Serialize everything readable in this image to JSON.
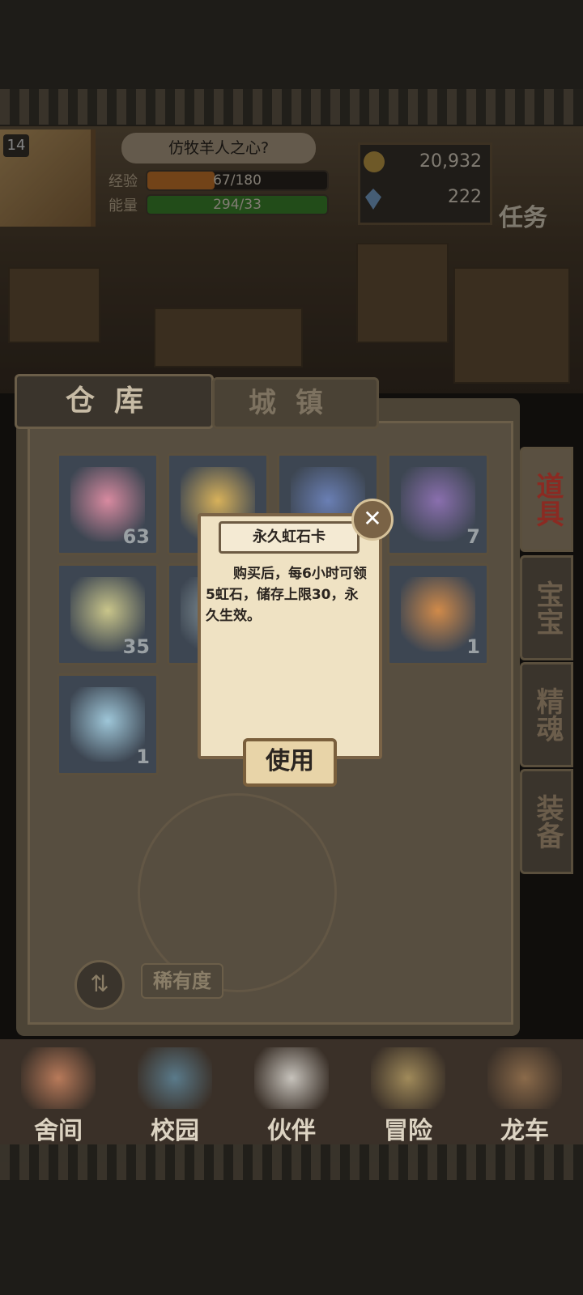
{
  "header": {
    "level": "14",
    "title": "仿牧羊人之心?",
    "exp_label": "经验",
    "exp_value": "67/180",
    "exp_fraction": 0.372,
    "energy_label": "能量",
    "energy_value": "294/33",
    "energy_fraction": 1.0,
    "gold": "20,932",
    "gems": "222",
    "task_label": "任务"
  },
  "tabs": {
    "warehouse": "仓库",
    "town": "城镇"
  },
  "side_tabs": [
    "道具",
    "宝宝",
    "精魂",
    "装备"
  ],
  "inventory": [
    {
      "name": "pink-ticket",
      "count": "63",
      "color": "#d88aa0"
    },
    {
      "name": "yellow-ticket",
      "count": "",
      "color": "#d7b15a"
    },
    {
      "name": "blue-cat",
      "count": "",
      "color": "#6a7fb4"
    },
    {
      "name": "purple-crystal",
      "count": "7",
      "color": "#8a6fae"
    },
    {
      "name": "winged-clock",
      "count": "35",
      "color": "#c9c58a"
    },
    {
      "name": "ring-item",
      "count": "",
      "color": "#8a9aa0"
    },
    {
      "name": "hidden-item",
      "count": "",
      "color": "#6a6a6a"
    },
    {
      "name": "gift-bag",
      "count": "1",
      "color": "#d08a4a"
    },
    {
      "name": "rainbow-potion",
      "count": "1",
      "color": "#9ec6d8"
    }
  ],
  "controls": {
    "sort_icon": "⇅",
    "rarity_label": "稀有度"
  },
  "popup": {
    "title": "永久虹石卡",
    "description": "购买后，每6小时可领5虹石，储存上限30，永久生效。",
    "close_icon": "✕",
    "use_label": "使用"
  },
  "bottom_nav": [
    {
      "label": "舍间",
      "color": "#b87a5a"
    },
    {
      "label": "校园",
      "color": "#5a7a8a"
    },
    {
      "label": "伙伴",
      "color": "#c6c2bb"
    },
    {
      "label": "冒险",
      "color": "#a08a5a"
    },
    {
      "label": "龙车",
      "color": "#8a6a4a"
    }
  ]
}
